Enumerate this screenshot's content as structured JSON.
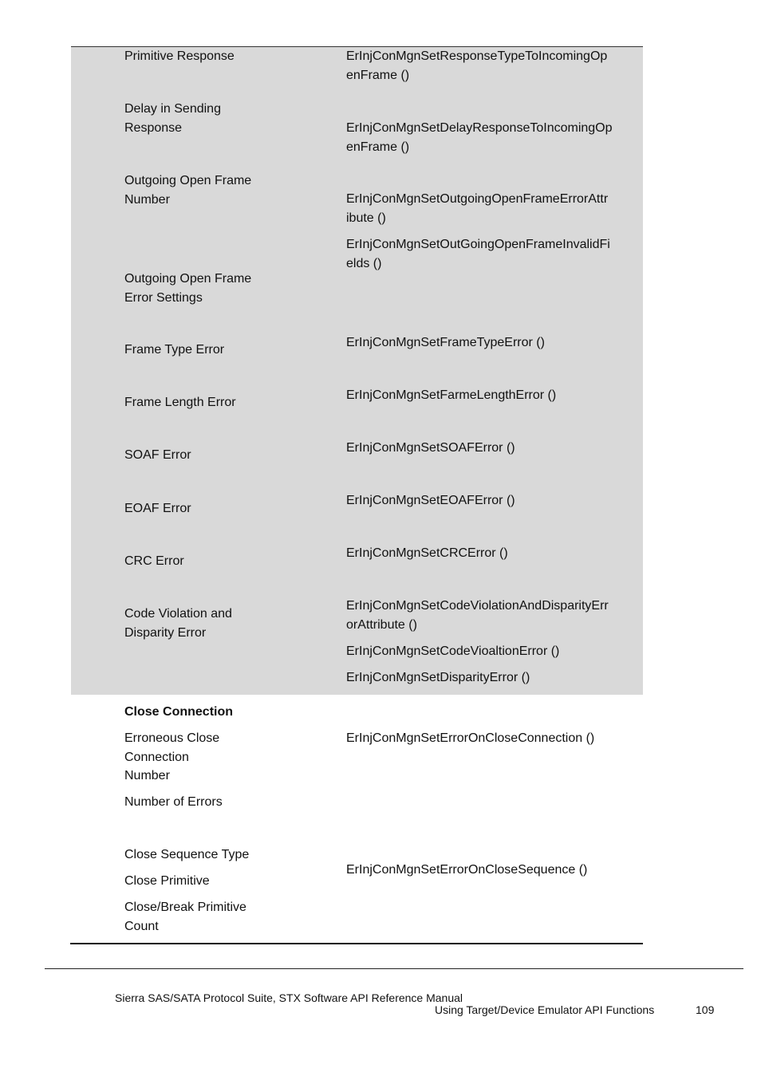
{
  "table": {
    "shaded_rows": [
      {
        "label": [
          "Primitive Response"
        ],
        "functions": [
          [
            "ErInjConMgnSetResponseTypeToIncomingOp",
            "enFrame ()"
          ]
        ]
      },
      {
        "label": [
          "Delay in Sending",
          "Response"
        ],
        "functions": [
          [
            "ErInjConMgnSetDelayResponseToIncomingOp",
            "enFrame ()"
          ]
        ]
      },
      {
        "label": [
          "Outgoing Open Frame",
          "Number"
        ],
        "functions": [
          [
            "ErInjConMgnSetOutgoingOpenFrameErrorAttr",
            "ibute ()"
          ],
          [
            "ErInjConMgnSetOutGoingOpenFrameInvalidFi",
            "elds ()"
          ]
        ]
      },
      {
        "label": [
          "Outgoing Open Frame",
          "Error Settings"
        ],
        "functions": []
      },
      {
        "label": [
          "Frame Type Error"
        ],
        "functions": [
          [
            "ErInjConMgnSetFrameTypeError ()"
          ]
        ]
      },
      {
        "label": [
          "Frame Length Error"
        ],
        "functions": [
          [
            "ErInjConMgnSetFarmeLengthError ()"
          ]
        ]
      },
      {
        "label": [
          "SOAF Error"
        ],
        "functions": [
          [
            "ErInjConMgnSetSOAFError ()"
          ]
        ]
      },
      {
        "label": [
          "EOAF Error"
        ],
        "functions": [
          [
            "ErInjConMgnSetEOAFError ()"
          ]
        ]
      },
      {
        "label": [
          "CRC Error"
        ],
        "functions": [
          [
            "ErInjConMgnSetCRCError ()"
          ]
        ]
      },
      {
        "label": [
          "Code Violation and",
          "Disparity Error"
        ],
        "functions": [
          [
            "ErInjConMgnSetCodeViolationAndDisparityErr",
            "orAttribute ()"
          ],
          [
            "ErInjConMgnSetCodeVioaltionError ()"
          ],
          [
            "ErInjConMgnSetDisparityError ()"
          ]
        ]
      }
    ],
    "close_section": {
      "heading": "Close Connection",
      "labels": {
        "erroneous": [
          "Erroneous Close",
          "Connection",
          "Number"
        ],
        "num_errors": "Number of Errors",
        "seq_type": "Close Sequence Type",
        "close_primitive": "Close Primitive",
        "break_count": [
          "Close/Break Primitive",
          "Count"
        ]
      },
      "functions": {
        "error_on_close_connection": "ErInjConMgnSetErrorOnCloseConnection ()",
        "error_on_close_sequence": "ErInjConMgnSetErrorOnCloseSequence ()"
      }
    }
  },
  "footer": {
    "manual_title": "Sierra SAS/SATA Protocol Suite, STX Software API Reference Manual",
    "section": "Using Target/Device Emulator API Functions",
    "page_number": "109"
  },
  "colors": {
    "shade": "#d9d9d9",
    "rule": "#111111"
  }
}
